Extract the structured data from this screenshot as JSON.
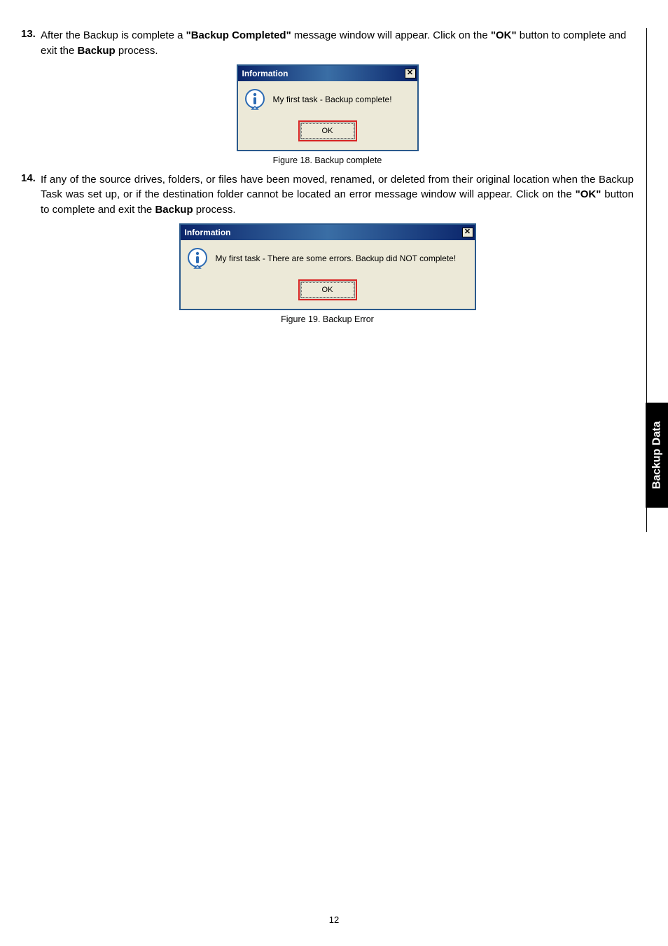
{
  "items": [
    {
      "num": "13.",
      "parts": [
        {
          "t": "After the Backup is complete a ",
          "b": false
        },
        {
          "t": "\"Backup Completed\"",
          "b": true
        },
        {
          "t": " message window will appear. Click on the ",
          "b": false
        },
        {
          "t": "\"OK\"",
          "b": true
        },
        {
          "t": " button to complete and exit the ",
          "b": false
        },
        {
          "t": "Backup",
          "b": true
        },
        {
          "t": " process.",
          "b": false
        }
      ]
    },
    {
      "num": "14.",
      "parts": [
        {
          "t": "If any of the source drives, folders, or files have been moved, renamed, or deleted from their original location when the Backup Task was set up, or if the destination folder cannot be located an error message window will appear. Click on the ",
          "b": false
        },
        {
          "t": "\"OK\"",
          "b": true
        },
        {
          "t": " button to complete and exit the ",
          "b": false
        },
        {
          "t": "Backup",
          "b": true
        },
        {
          "t": " process.",
          "b": false
        }
      ]
    }
  ],
  "dialog1": {
    "title": "Information",
    "message": "My first task - Backup complete!",
    "ok": "OK",
    "caption": "Figure 18. Backup complete"
  },
  "dialog2": {
    "title": "Information",
    "message": "My first task - There are some errors. Backup did NOT complete!",
    "ok": "OK",
    "caption": "Figure 19. Backup Error"
  },
  "sideTab": "Backup Data",
  "pageNumber": "12"
}
